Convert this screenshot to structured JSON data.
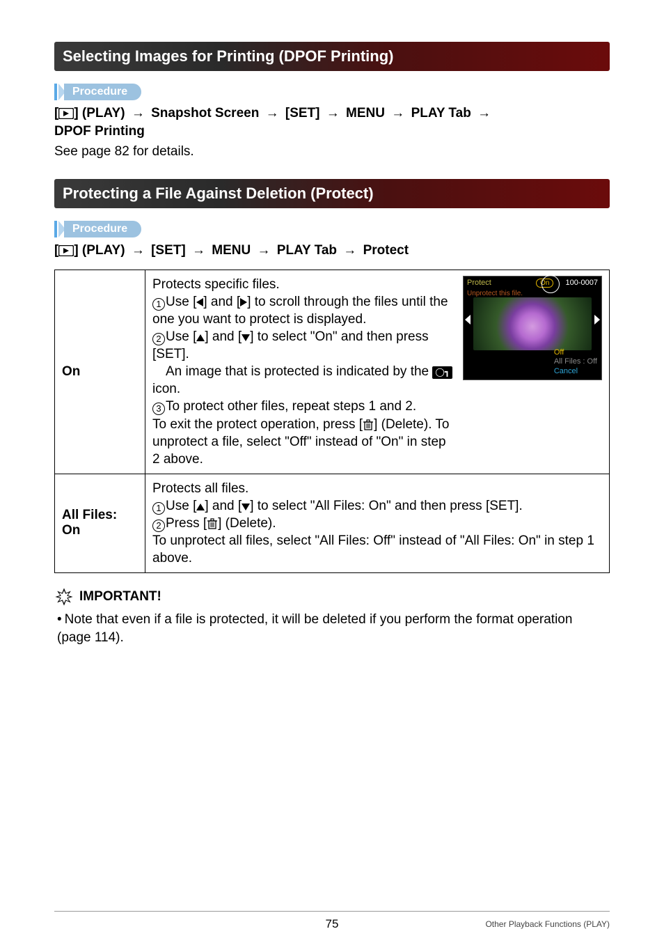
{
  "section1": {
    "title": "Selecting Images for Printing (DPOF Printing)",
    "procedure_label": "Procedure",
    "path_prefix": "[",
    "path_play": "] (PLAY)",
    "arrow": "*",
    "seg_snapshot": "Snapshot Screen",
    "seg_set": "[SET]",
    "seg_menu": "MENU",
    "seg_playtab": "PLAY Tab",
    "seg_dpof": "DPOF Printing",
    "body": "See page 82 for details."
  },
  "section2": {
    "title": "Protecting a File Against Deletion (Protect)",
    "procedure_label": "Procedure",
    "path_prefix": "[",
    "path_play": "] (PLAY)",
    "seg_set": "[SET]",
    "seg_menu": "MENU",
    "seg_playtab": "PLAY Tab",
    "seg_protect": "Protect"
  },
  "table": {
    "row1": {
      "label": "On",
      "line_intro": "Protects specific files.",
      "step1a": "Use [",
      "step1b": "] and [",
      "step1c": "] to scroll through the files until the one you want to protect is displayed.",
      "step2a": "Use [",
      "step2b": "] and [",
      "step2c": "] to select \"On\" and then press [SET].",
      "indicated_a": "An image that is protected is indicated by the ",
      "indicated_b": " icon.",
      "step3": "To protect other files, repeat steps 1 and 2.",
      "exit_a": "To exit the protect operation, press [",
      "exit_b": "] (Delete). To unprotect a file, select \"Off\" instead of \"On\" in step 2 above."
    },
    "row2": {
      "label": "All Files: On",
      "line_intro": "Protects all files.",
      "step1a": "Use [",
      "step1b": "] and [",
      "step1c": "] to select \"All Files: On\" and then press [SET].",
      "step2a": "Press [",
      "step2b": "] (Delete).",
      "unprotect": "To unprotect all files, select \"All Files: Off\" instead of \"All Files: On\" in step 1 above."
    }
  },
  "screenshot": {
    "protect": "Protect",
    "on_badge": "On",
    "counter": "100-0007",
    "unprotect": "Unprotect this file.",
    "menu_off": "Off",
    "menu_all": "All Files : Off",
    "menu_cancel": "Cancel"
  },
  "important": {
    "label": "IMPORTANT!",
    "bullet": "•",
    "text": "Note that even if a file is protected, it will be deleted if you perform the format operation (page 114)."
  },
  "footer": {
    "page": "75",
    "right": "Other Playback Functions (PLAY)"
  }
}
